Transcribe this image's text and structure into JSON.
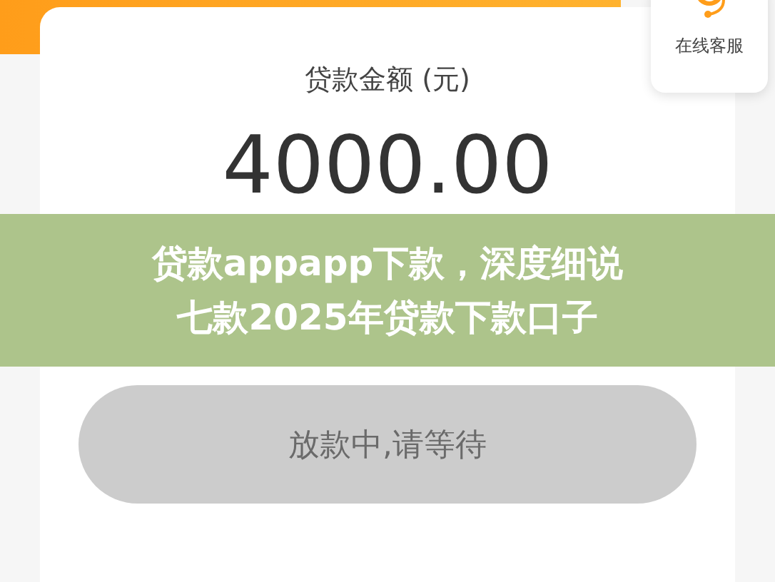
{
  "loan_card": {
    "label": "贷款金额 (元)",
    "amount": "4000.00"
  },
  "service_widget": {
    "label": "在线客服"
  },
  "banner": {
    "lines": [
      "贷款appapp下款，深度细说",
      "七款2025年贷款下款口子"
    ]
  },
  "action_button": {
    "label": "放款中,请等待",
    "disabled": true
  }
}
